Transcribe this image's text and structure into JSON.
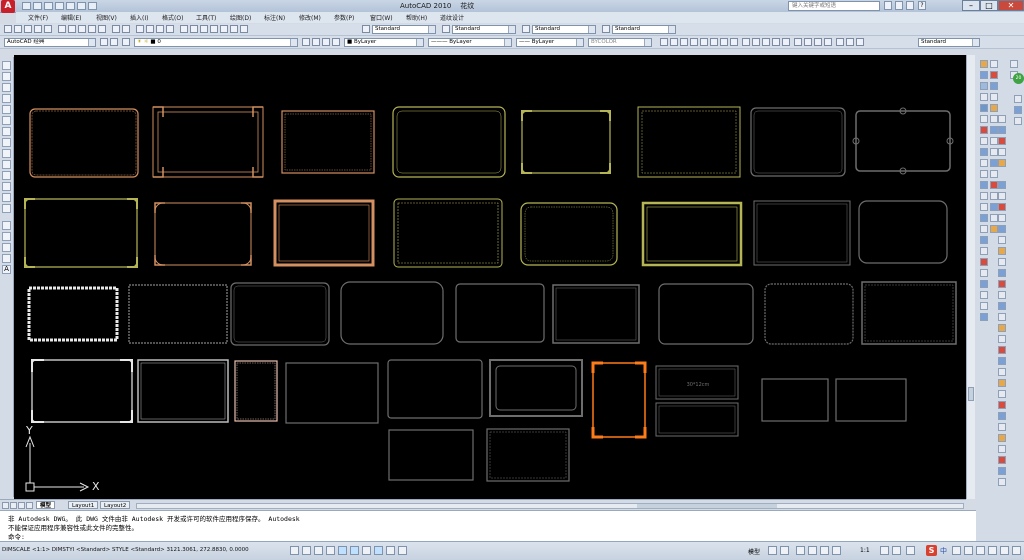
{
  "window": {
    "title": "AutoCAD 2010",
    "filename": "花纹",
    "search_placeholder": "键入关键字或短语"
  },
  "menus": [
    "文件(F)",
    "编辑(E)",
    "视图(V)",
    "插入(I)",
    "格式(O)",
    "工具(T)",
    "绘图(D)",
    "标注(N)",
    "修改(M)",
    "参数(P)",
    "窗口(W)",
    "帮助(H)",
    "道纹设计"
  ],
  "toolbar": {
    "text_style": "Standard",
    "dim_style": "Standard",
    "table_style": "Standard",
    "mleader_style": "Standard",
    "workspace": "AutoCAD 经典",
    "layer": "0",
    "color": "ByLayer",
    "linetype": "ByLayer",
    "lineweight": "ByLayer",
    "plotstyle": "BYCOLOR",
    "anno_style": "Standard"
  },
  "tabs": [
    "模型",
    "Layout1",
    "Layout2"
  ],
  "command": {
    "line1": "非 Autodesk DWG。  此 DWG 文件由非 Autodesk 开发或许可的软件应用程序保存。  Autodesk",
    "line2": "不能保证应用程序兼容性或此文件的完整性。",
    "prompt": "命令:"
  },
  "status": {
    "coords": "DIMSCALE <1:1> DIMSTYI <Standard> STYLE <Standard>   3121.3061, 272.8830, 0.0000",
    "model": "模型",
    "scale": "1:1"
  },
  "drawing": {
    "frame_label": "30*12cm",
    "ucs_x": "X",
    "ucs_y": "Y"
  },
  "colors": {
    "canvas": "#000000",
    "peach": "#d49060",
    "olive": "#b5b556",
    "gray": "#6e6e6e",
    "white": "#e8e8e8",
    "orange": "#ff7a18",
    "cad_red": "#c8202a"
  }
}
